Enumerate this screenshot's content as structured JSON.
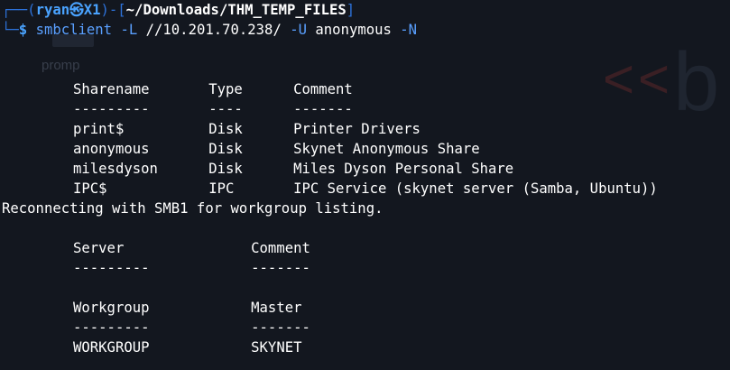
{
  "watermark": {
    "prompt_text": "promp",
    "logo_chevrons": "<<",
    "logo_letter": "b"
  },
  "prompt": {
    "corner_top": "┌──(",
    "user_host": "ryan㉿X1",
    "sep_mid": ")-[",
    "path": "~/Downloads/THM_TEMP_FILES",
    "close": "]",
    "corner_bottom": "└─",
    "dollar": "$",
    "command": "smbclient",
    "flag_L": "-L",
    "target": "//10.201.70.238/",
    "flag_U": "-U",
    "user_arg": "anonymous",
    "flag_N": "-N"
  },
  "shares_table": {
    "header": "Sharename       Type      Comment",
    "divider": "---------       ----      -------",
    "rows": [
      "print$          Disk      Printer Drivers",
      "anonymous       Disk      Skynet Anonymous Share",
      "milesdyson      Disk      Miles Dyson Personal Share",
      "IPC$            IPC       IPC Service (skynet server (Samba, Ubuntu))"
    ]
  },
  "reconnect_message": "Reconnecting with SMB1 for workgroup listing.",
  "server_table": {
    "header": "Server               Comment",
    "divider": "---------            -------"
  },
  "workgroup_table": {
    "header": "Workgroup            Master",
    "divider": "---------            -------",
    "rows": [
      "WORKGROUP            SKYNET"
    ]
  }
}
